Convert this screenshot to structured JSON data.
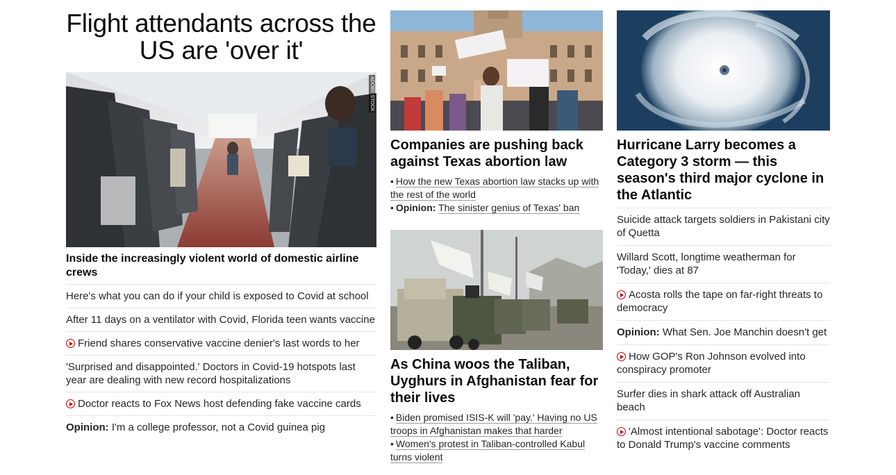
{
  "left": {
    "headline": "Flight attendants across the US are 'over it'",
    "image_credit": "ADOBE STOCK",
    "lead_link": "Inside the increasingly violent world of domestic airline crews",
    "items": [
      {
        "text": "Here's what you can do if your child is exposed to Covid at school"
      },
      {
        "text": "After 11 days on a ventilator with Covid, Florida teen wants vaccine"
      },
      {
        "text": "Friend shares conservative vaccine denier's last words to her",
        "video": true
      },
      {
        "text": "'Surprised and disappointed.' Doctors in Covid-19 hotspots last year are dealing with new record hospitalizations"
      },
      {
        "text": "Doctor reacts to Fox News host defending fake vaccine cards",
        "video": true
      },
      {
        "prefix": "Opinion:",
        "text": "I'm a college professor, not a Covid guinea pig"
      }
    ]
  },
  "middle": {
    "story1": {
      "headline": "Companies are pushing back against Texas abortion law",
      "sub1": "How the new Texas abortion law stacks up with the rest of the world",
      "sub2_prefix": "Opinion:",
      "sub2": "The sinister genius of Texas' ban"
    },
    "story2": {
      "headline": "As China woos the Taliban, Uyghurs in Afghanistan fear for their lives",
      "sub1": "Biden promised ISIS-K will 'pay.' Having no US troops in Afghanistan makes that harder",
      "sub2": "Women's protest in Taliban-controlled Kabul turns violent"
    }
  },
  "right": {
    "headline": "Hurricane Larry becomes a Category 3 storm — this season's third major cyclone in the Atlantic",
    "items": [
      {
        "text": "Suicide attack targets soldiers in Pakistani city of Quetta"
      },
      {
        "text": "Willard Scott, longtime weatherman for 'Today,' dies at 87"
      },
      {
        "text": "Acosta rolls the tape on far-right threats to democracy",
        "video": true
      },
      {
        "prefix": "Opinion:",
        "text": "What Sen. Joe Manchin doesn't get"
      },
      {
        "text": "How GOP's Ron Johnson evolved into conspiracy promoter",
        "video": true
      },
      {
        "text": "Surfer dies in shark attack off Australian beach"
      },
      {
        "text": "'Almost intentional sabotage': Doctor reacts to Donald Trump's vaccine comments",
        "video": true
      }
    ]
  },
  "colors": {
    "video_icon": "#cc0000",
    "divider": "#e6e6e6",
    "text": "#262626"
  }
}
